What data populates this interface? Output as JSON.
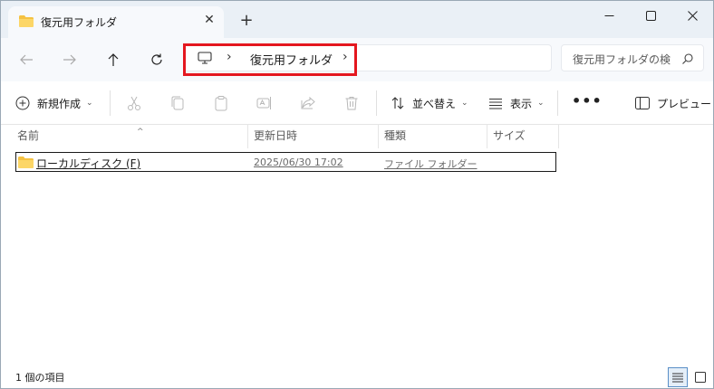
{
  "tab": {
    "title": "復元用フォルダ",
    "close": "✕",
    "new_tab": "+"
  },
  "window_controls": {
    "minimize": "minimize",
    "maximize": "maximize",
    "close": "close"
  },
  "address": {
    "separator1": "›",
    "crumb": "復元用フォルダ",
    "separator2": "›"
  },
  "search": {
    "placeholder": "復元用フォルダの検"
  },
  "toolbar": {
    "new_label": "新規作成",
    "sort_label": "並べ替え",
    "view_label": "表示",
    "more": "•••",
    "preview_label": "プレビュー"
  },
  "columns": {
    "name": "名前",
    "date": "更新日時",
    "type": "種類",
    "size": "サイズ"
  },
  "rows": [
    {
      "name": "ローカルディスク (F)",
      "date": "2025/06/30 17:02",
      "type": "ファイル フォルダー"
    }
  ],
  "status": {
    "item_count": "1 個の項目"
  },
  "colors": {
    "folder": "#f5c242",
    "highlight": "#e4171f",
    "titlebar": "#eaf0f6"
  }
}
